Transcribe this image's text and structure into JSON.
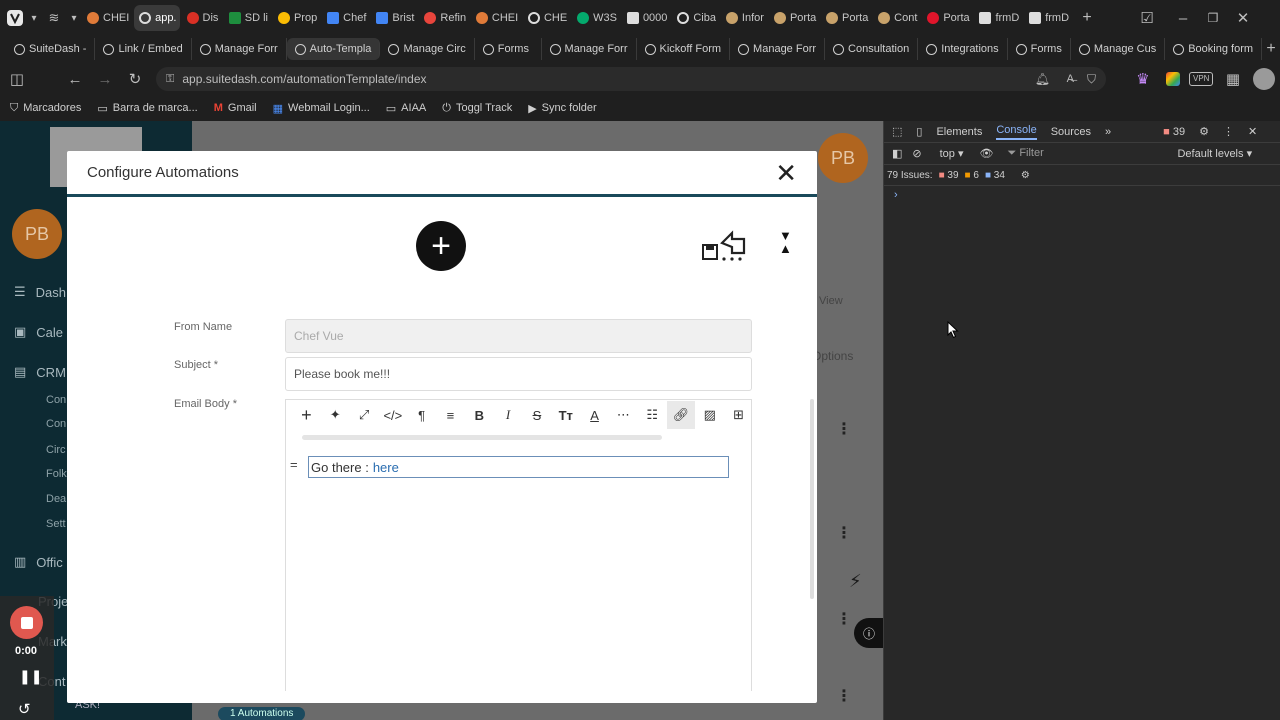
{
  "browser": {
    "tabs": [
      "CHEI",
      "app.",
      "Dis",
      "SD li",
      "Prop",
      "Chef",
      "Brist",
      "Refin",
      "CHEI",
      "CHE",
      "W3S",
      "0000",
      "Ciba",
      "Infor",
      "Porta",
      "Porta",
      "Cont",
      "Porta",
      "frmD",
      "frmD"
    ],
    "pinned_tabs": [
      "SuiteDash -",
      "Link / Embed",
      "Manage Forr",
      "Auto-Templa",
      "Manage Circ",
      "Forms",
      "Manage Forr",
      "Kickoff Form",
      "Manage Forr",
      "Consultation",
      "Integrations",
      "Forms",
      "Manage Cus",
      "Booking form"
    ],
    "url": "app.suitedash.com/automationTemplate/index",
    "bookmarks": [
      "Marcadores",
      "Barra de marca...",
      "Gmail",
      "Webmail Login...",
      "AIAA",
      "Toggl Track",
      "Sync folder"
    ],
    "vpn_label": "VPN"
  },
  "app": {
    "avatar_initials": "PB",
    "sidebar": {
      "items": [
        "Dash",
        "Cale",
        "CRM",
        "Offic",
        "Proje",
        "Mark",
        "Cont"
      ],
      "sub_items": [
        "Con",
        "Con",
        "Circ",
        "Folk",
        "Dea",
        "Sett"
      ]
    },
    "background_fragments": [
      "View",
      "Options"
    ],
    "ask_label": "ASK!",
    "automations_badge": "1 Automations"
  },
  "modal": {
    "title": "Configure Automations",
    "from_name_label": "From Name",
    "from_name_value": "Chef Vue",
    "subject_label": "Subject *",
    "subject_value": "Please book me!!!",
    "email_body_label": "Email Body *",
    "body_text": "Go there :",
    "body_link": "here"
  },
  "devtools": {
    "tabs": [
      "Elements",
      "Console",
      "Sources"
    ],
    "error_count": "39",
    "context": "top",
    "filter_placeholder": "Filter",
    "levels": "Default levels",
    "issues_label": "79 Issues:",
    "issues_errors": "39",
    "issues_warnings": "6",
    "issues_info": "34"
  },
  "recorder": {
    "time": "0:00"
  }
}
